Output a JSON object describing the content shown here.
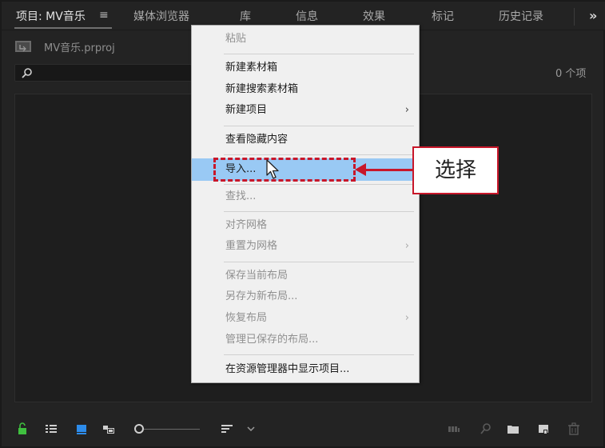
{
  "tabs": [
    {
      "label": "项目: MV音乐",
      "active": true
    },
    {
      "label": "媒体浏览器"
    },
    {
      "label": "库"
    },
    {
      "label": "信息"
    },
    {
      "label": "效果"
    },
    {
      "label": "标记"
    },
    {
      "label": "历史记录"
    }
  ],
  "tab_menu_icon": "hamburger-icon",
  "overflow_icon": "double-chevron-right-icon",
  "overflow_label": "»",
  "project": {
    "filename": "MV音乐.prproj"
  },
  "search": {
    "placeholder": "",
    "icon": "search-icon"
  },
  "item_count": "0 个项",
  "context_menu": {
    "items": [
      {
        "label": "粘贴",
        "disabled": true
      },
      {
        "label": "新建素材箱"
      },
      {
        "label": "新建搜索素材箱"
      },
      {
        "label": "新建项目",
        "submenu": true
      },
      {
        "label": "查看隐藏内容"
      },
      {
        "label": "导入...",
        "highlight": true
      },
      {
        "label": "查找...",
        "disabled": true
      },
      {
        "label": "对齐网格",
        "disabled": true
      },
      {
        "label": "重置为网格",
        "disabled": true,
        "submenu": true
      },
      {
        "label": "保存当前布局",
        "disabled": true
      },
      {
        "label": "另存为新布局...",
        "disabled": true
      },
      {
        "label": "恢复布局",
        "disabled": true,
        "submenu": true
      },
      {
        "label": "管理已保存的布局...",
        "disabled": true
      },
      {
        "label": "在资源管理器中显示项目..."
      }
    ],
    "submenu_arrow": "›"
  },
  "annotation": {
    "callout_text": "选择",
    "color": "#c8172a"
  },
  "colors": {
    "highlight": "#99c9f4",
    "lock_icon": "#3fbf3f",
    "accent_blue": "#2d8ceb"
  }
}
